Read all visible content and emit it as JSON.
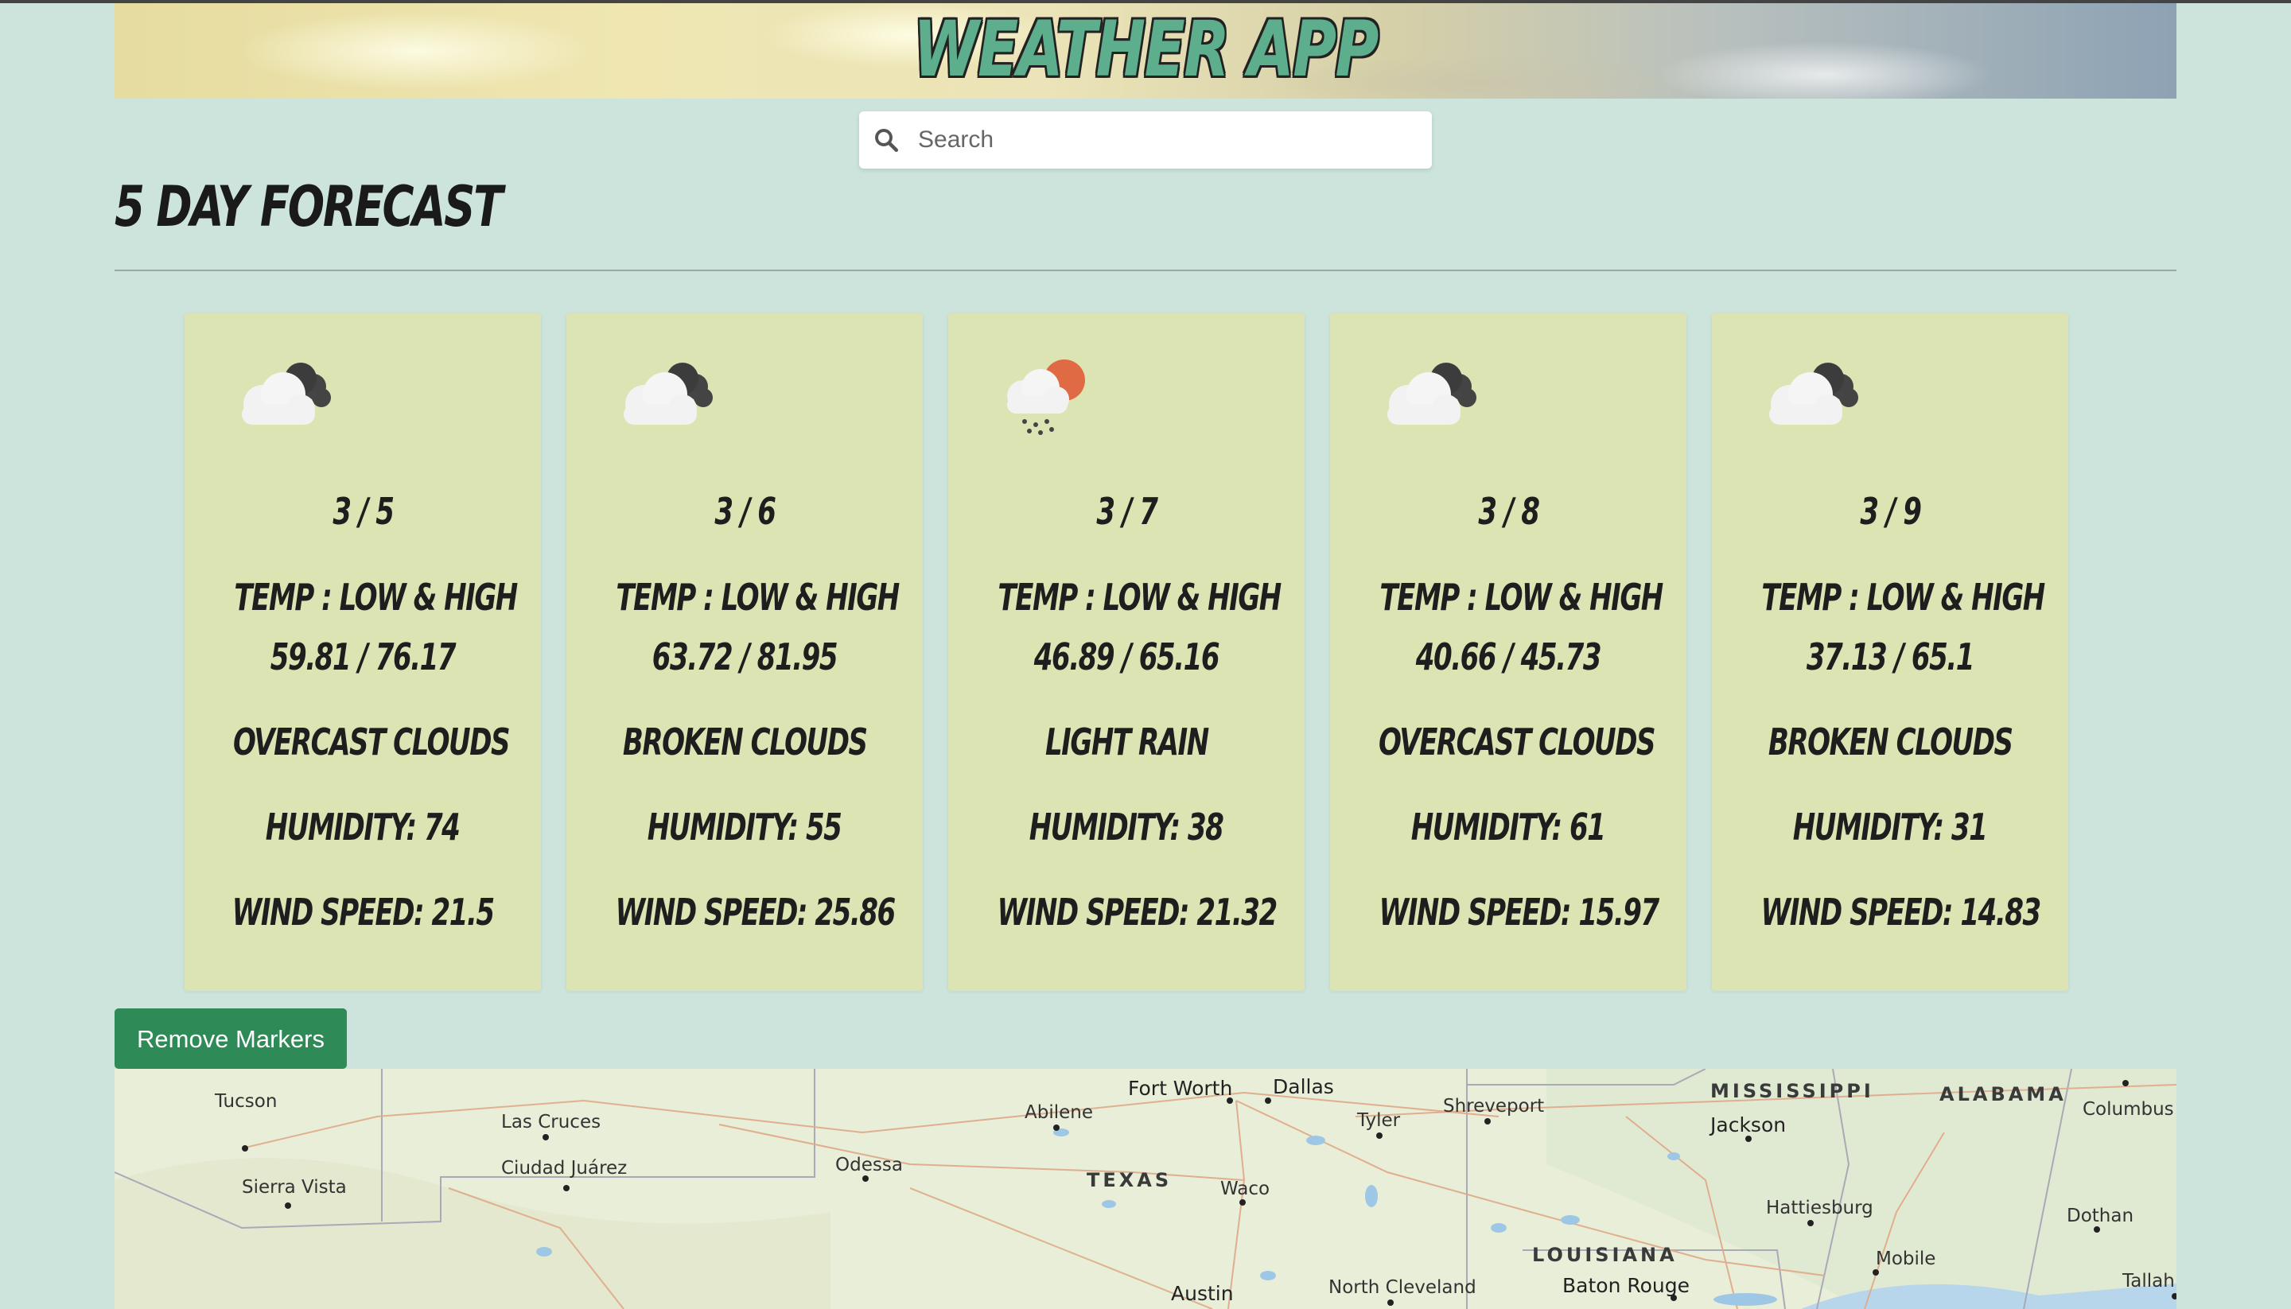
{
  "app": {
    "title": "WEATHER APP"
  },
  "search": {
    "placeholder": "Search"
  },
  "forecast": {
    "heading": "5 DAY FORECAST",
    "days": [
      {
        "date": "3 / 5",
        "temp_label": "TEMP : LOW & HIGH",
        "temps": "59.81 / 76.17",
        "condition": "OVERCAST CLOUDS",
        "humidity": "HUMIDITY: 74",
        "wind": "WIND SPEED: 21.5",
        "icon": "broken-clouds-icon"
      },
      {
        "date": "3 / 6",
        "temp_label": "TEMP : LOW & HIGH",
        "temps": "63.72 / 81.95",
        "condition": "BROKEN CLOUDS",
        "humidity": "HUMIDITY: 55",
        "wind": "WIND SPEED: 25.86",
        "icon": "broken-clouds-icon"
      },
      {
        "date": "3 / 7",
        "temp_label": "TEMP : LOW & HIGH",
        "temps": "46.89 / 65.16",
        "condition": "LIGHT RAIN",
        "humidity": "HUMIDITY: 38",
        "wind": "WIND SPEED: 21.32",
        "icon": "rain-sun-icon"
      },
      {
        "date": "3 / 8",
        "temp_label": "TEMP : LOW & HIGH",
        "temps": "40.66 / 45.73",
        "condition": "OVERCAST CLOUDS",
        "humidity": "HUMIDITY: 61",
        "wind": "WIND SPEED: 15.97",
        "icon": "broken-clouds-icon"
      },
      {
        "date": "3 / 9",
        "temp_label": "TEMP : LOW & HIGH",
        "temps": "37.13 / 65.1",
        "condition": "BROKEN CLOUDS",
        "humidity": "HUMIDITY: 31",
        "wind": "WIND SPEED: 14.83",
        "icon": "broken-clouds-icon"
      }
    ]
  },
  "controls": {
    "remove_markers": "Remove Markers"
  },
  "map": {
    "states": [
      "TEXAS",
      "LOUISIANA",
      "MISSISSIPPI",
      "ALABAMA"
    ],
    "cities": [
      "Tucson",
      "Las Cruces",
      "Ciudad Juárez",
      "Sierra Vista",
      "Odessa",
      "Abilene",
      "Fort Worth",
      "Dallas",
      "Tyler",
      "Shreveport",
      "Waco",
      "Austin",
      "North Cleveland",
      "Baton Rouge",
      "Jackson",
      "Hattiesburg",
      "Mobile",
      "Columbus",
      "Dothan",
      "Tallah"
    ]
  },
  "colors": {
    "background": "#cde4dd",
    "card": "#dce4b4",
    "button": "#2e8a57",
    "title_fill": "#5cae8c"
  }
}
